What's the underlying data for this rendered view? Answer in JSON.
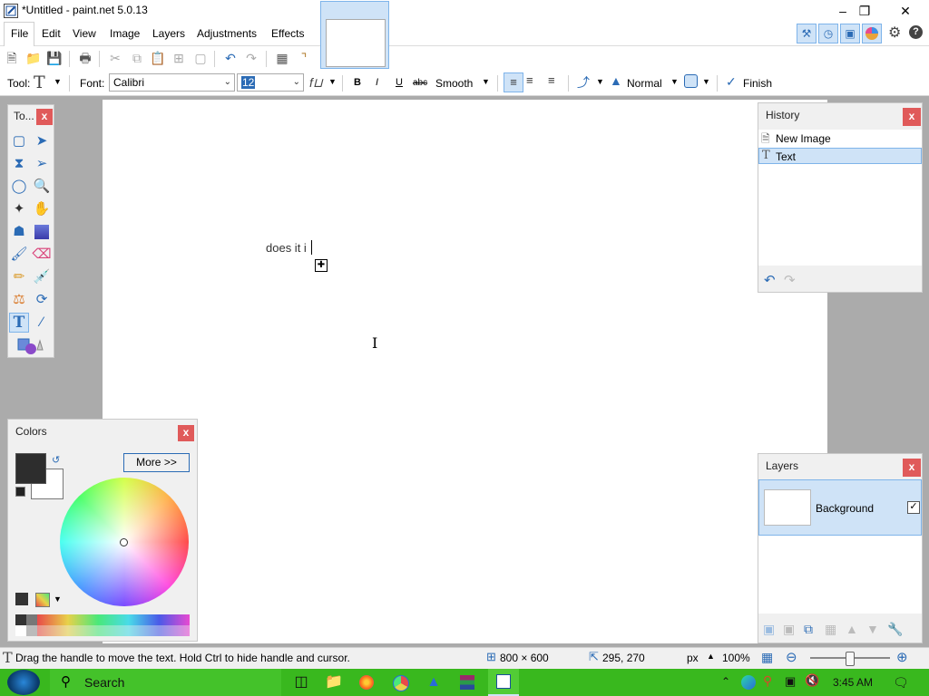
{
  "window": {
    "title": "*Untitled - paint.net 5.0.13"
  },
  "menu": {
    "items": [
      "File",
      "Edit",
      "View",
      "Image",
      "Layers",
      "Adjustments",
      "Effects"
    ]
  },
  "toolbar2": {
    "tool_label": "Tool:",
    "font_label": "Font:",
    "font_value": "Calibri",
    "size_value": "12",
    "rendering_value": "Smooth",
    "blend_value": "Normal",
    "finish_label": "Finish",
    "bold": "B",
    "italic": "I",
    "underline": "U",
    "strike": "abc"
  },
  "canvas": {
    "text": "does it i"
  },
  "tools_panel": {
    "title": "To..."
  },
  "history_panel": {
    "title": "History",
    "items": [
      "New Image",
      "Text"
    ]
  },
  "layers_panel": {
    "title": "Layers",
    "layer_name": "Background"
  },
  "colors_panel": {
    "title": "Colors",
    "more_label": "More >>"
  },
  "statusbar": {
    "hint": "Drag the handle to move the text. Hold Ctrl to hide handle and cursor.",
    "image_size": "800 × 600",
    "cursor_pos": "295, 270",
    "units": "px",
    "zoom": "100%"
  },
  "taskbar": {
    "search": "Search",
    "time": "3:45 AM"
  },
  "colors": {
    "accent": "#39b81e",
    "close": "#e05a5a",
    "selection": "#cfe3f7",
    "primary_color": "#2d2d2d"
  }
}
